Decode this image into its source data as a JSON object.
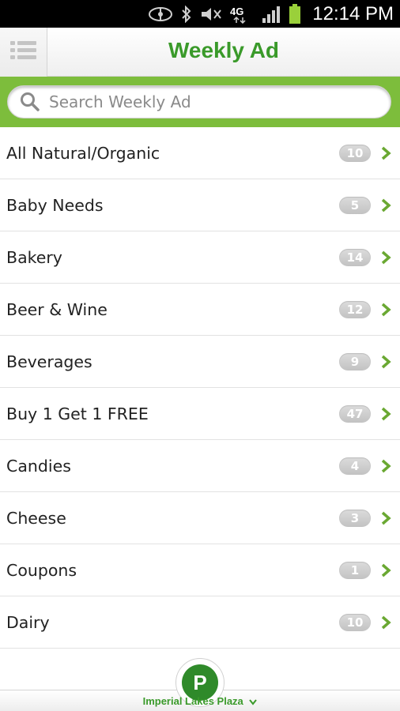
{
  "status_bar": {
    "time": "12:14 PM",
    "icons": [
      "sync-icon",
      "bluetooth-icon",
      "mute-icon",
      "4g-icon",
      "signal-icon",
      "battery-icon"
    ],
    "network_label": "4G"
  },
  "header": {
    "title": "Weekly Ad",
    "menu_icon": "list-menu-icon"
  },
  "search": {
    "placeholder": "Search Weekly Ad",
    "value": ""
  },
  "categories": [
    {
      "label": "All Natural/Organic",
      "count": "10"
    },
    {
      "label": "Baby Needs",
      "count": "5"
    },
    {
      "label": "Bakery",
      "count": "14"
    },
    {
      "label": "Beer & Wine",
      "count": "12"
    },
    {
      "label": "Beverages",
      "count": "9"
    },
    {
      "label": "Buy 1 Get 1 FREE",
      "count": "47"
    },
    {
      "label": "Candies",
      "count": "4"
    },
    {
      "label": "Cheese",
      "count": "3"
    },
    {
      "label": "Coupons",
      "count": "1"
    },
    {
      "label": "Dairy",
      "count": "10"
    }
  ],
  "footer": {
    "store_name": "Imperial Lakes Plaza",
    "logo_letter": "P"
  },
  "colors": {
    "brand_green": "#3a9a2a",
    "search_band": "#7dbd3c",
    "badge_gray": "#c8c8c8",
    "chevron_green": "#6aa832"
  }
}
